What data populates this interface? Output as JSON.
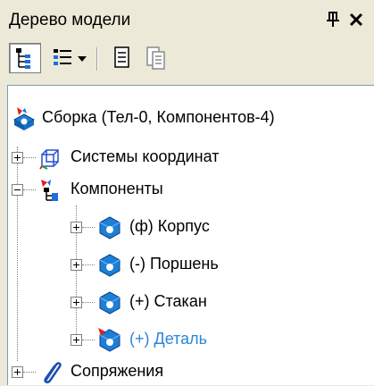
{
  "window": {
    "title": "Дерево модели"
  },
  "toolbar": {
    "buttons": [
      {
        "icon": "tree-structure-icon",
        "pressed": true
      },
      {
        "icon": "list-view-icon",
        "dropdown": true
      },
      {
        "icon": "properties-icon"
      },
      {
        "icon": "report-icon",
        "disabled": true
      }
    ]
  },
  "tree": {
    "root": {
      "label": "Сборка (Тел-0, Компонентов-4)",
      "icon": "assembly-icon"
    },
    "items": [
      {
        "label": "Системы координат",
        "icon": "coordinate-system-icon",
        "expanded": false
      },
      {
        "label": "Компоненты",
        "icon": "components-icon",
        "expanded": true
      },
      {
        "label": "(ф) Корпус",
        "icon": "part-icon"
      },
      {
        "label": "(-) Поршень",
        "icon": "part-icon"
      },
      {
        "label": "(+) Стакан",
        "icon": "part-icon"
      },
      {
        "label": "(+) Деталь",
        "icon": "part-edit-icon",
        "highlight_color": "#2d86d9"
      },
      {
        "label": "Сопряжения",
        "icon": "mates-icon",
        "expanded": false
      }
    ]
  }
}
